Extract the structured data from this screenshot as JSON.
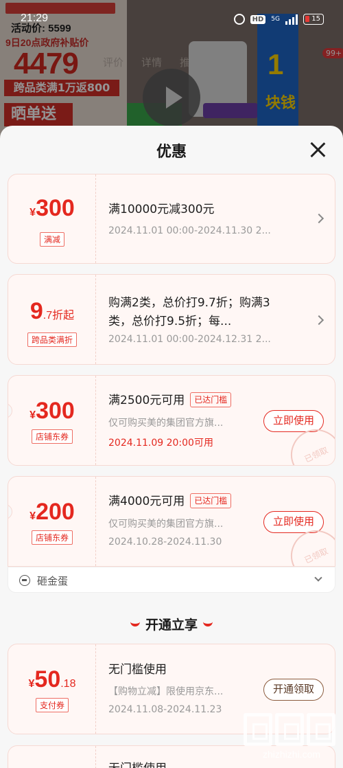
{
  "status_bar": {
    "time": "21:29",
    "network": "5G",
    "battery": "15"
  },
  "background": {
    "activity_price_label": "活动价:",
    "activity_price": "5599",
    "subsidy_line": "9日20点政府补贴价",
    "subsidy_price": "4479",
    "promo_line": "跨品类满1万返800",
    "share_label": "晒单送",
    "tabs": [
      "评价",
      "详情",
      "推荐"
    ],
    "side_banner_digit": "1",
    "side_banner_text": "块钱",
    "cart_badge": "99+"
  },
  "sheet": {
    "title": "优惠"
  },
  "coupons": [
    {
      "currency": "¥",
      "amount": "300",
      "tag": "满减",
      "title": "满10000元减300元",
      "date": "2024.11.01 00:00-2024.11.30 2..."
    },
    {
      "amount_big": "9",
      "amount_small": ".7折起",
      "tag": "跨品类满折",
      "title": "购满2类，总价打9.7折；购满3类，总价打9.5折；每...",
      "date": "2024.11.01 00:00-2024.12.31 2..."
    },
    {
      "currency": "¥",
      "amount": "300",
      "tag": "店铺东券",
      "title": "满2500元可用",
      "threshold": "已达门槛",
      "desc": "仅可购买美的集团官方旗...",
      "date": "2024.11.09 20:00可用",
      "button": "立即使用",
      "stamp": "已领取"
    },
    {
      "currency": "¥",
      "amount": "200",
      "tag": "店铺东券",
      "title": "满4000元可用",
      "threshold": "已达门槛",
      "desc": "仅可购买美的集团官方旗...",
      "date": "2024.10.28-2024.11.30",
      "button": "立即使用",
      "stamp": "已领取"
    }
  ],
  "more_row": {
    "label": "砸金蛋"
  },
  "member_section": {
    "title": "开通立享",
    "coupons": [
      {
        "currency": "¥",
        "amount": "50",
        "amount_decimal": ".18",
        "tag": "支付券",
        "title": "无门槛使用",
        "desc": "【购物立减】限使用京东...",
        "date": "2024.11.08-2024.11.23",
        "button": "开通领取"
      },
      {
        "title": "无门槛使用"
      }
    ]
  },
  "watermark": {
    "text": "zhizhizhi.com"
  },
  "colors": {
    "accent": "#e4281f",
    "coupon_bg": "#fff7f5"
  }
}
